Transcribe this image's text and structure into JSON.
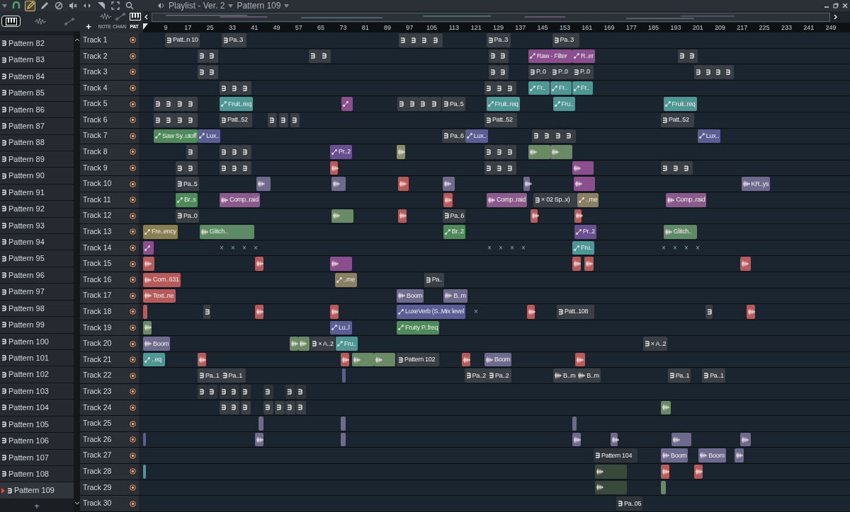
{
  "window": {
    "title": "Playlist - Ver. 2",
    "pattern": "Pattern 109"
  },
  "tools": [
    {
      "kind": "snap",
      "selected": false
    },
    {
      "kind": "draw",
      "selected": true
    },
    {
      "kind": "paint",
      "selected": false
    },
    {
      "kind": "delete",
      "selected": false
    },
    {
      "kind": "mute",
      "selected": false
    },
    {
      "kind": "slip",
      "selected": false
    },
    {
      "kind": "select",
      "selected": false
    },
    {
      "kind": "zoom",
      "selected": false
    },
    {
      "kind": "playback",
      "selected": false
    }
  ],
  "browser_tabs": [
    {
      "kind": "pattern",
      "selected": true
    },
    {
      "kind": "audio",
      "selected": false
    },
    {
      "kind": "automation",
      "selected": false
    }
  ],
  "view_tabs": [
    {
      "kind": "audio",
      "label": "NOTE",
      "selected": false
    },
    {
      "kind": "automation",
      "label": "CHAN",
      "selected": false
    },
    {
      "kind": "pattern",
      "label": "PAT",
      "selected": true
    }
  ],
  "patterns": [
    {
      "name": "Pattern 82",
      "selected": false
    },
    {
      "name": "Pattern 83",
      "selected": false
    },
    {
      "name": "Pattern 84",
      "selected": false
    },
    {
      "name": "Pattern 85",
      "selected": false
    },
    {
      "name": "Pattern 86",
      "selected": false
    },
    {
      "name": "Pattern 87",
      "selected": false
    },
    {
      "name": "Pattern 88",
      "selected": false
    },
    {
      "name": "Pattern 89",
      "selected": false
    },
    {
      "name": "Pattern 90",
      "selected": false
    },
    {
      "name": "Pattern 91",
      "selected": false
    },
    {
      "name": "Pattern 92",
      "selected": false
    },
    {
      "name": "Pattern 93",
      "selected": false
    },
    {
      "name": "Pattern 94",
      "selected": false
    },
    {
      "name": "Pattern 95",
      "selected": false
    },
    {
      "name": "Pattern 96",
      "selected": false
    },
    {
      "name": "Pattern 97",
      "selected": false
    },
    {
      "name": "Pattern 98",
      "selected": false
    },
    {
      "name": "Pattern 99",
      "selected": false
    },
    {
      "name": "Pattern 100",
      "selected": false
    },
    {
      "name": "Pattern 101",
      "selected": false
    },
    {
      "name": "Pattern 102",
      "selected": false
    },
    {
      "name": "Pattern 103",
      "selected": false
    },
    {
      "name": "Pattern 104",
      "selected": false
    },
    {
      "name": "Pattern 105",
      "selected": false
    },
    {
      "name": "Pattern 106",
      "selected": false
    },
    {
      "name": "Pattern 107",
      "selected": false
    },
    {
      "name": "Pattern 108",
      "selected": false
    },
    {
      "name": "Pattern 109",
      "selected": true
    }
  ],
  "add_pattern": "+",
  "add_track": "+",
  "ruler": [
    "9",
    "17",
    "25",
    "33",
    "41",
    "49",
    "57",
    "65",
    "73",
    "81",
    "89",
    "97",
    "105",
    "113",
    "121",
    "129",
    "137",
    "145",
    "153",
    "161",
    "169",
    "177",
    "185",
    "193",
    "201",
    "209",
    "217",
    "225",
    "233",
    "241",
    "249"
  ],
  "tracks": [
    {
      "name": "Track 1",
      "clips": [
        {
          "kind": "pattern",
          "label": "Patt..n 10",
          "color": "#3a3f46"
        },
        {
          "kind": "pattern",
          "label": "Pa..3",
          "color": "#3a3f46"
        },
        {
          "kind": "pattern",
          "color": "#3a3f46"
        },
        {
          "kind": "pattern",
          "color": "#3a3f46"
        },
        {
          "kind": "pattern",
          "color": "#3a3f46"
        },
        {
          "kind": "pattern",
          "color": "#3a3f46"
        },
        {
          "kind": "pattern",
          "label": "Pa..3",
          "color": "#3a3f46"
        },
        {
          "kind": "pattern",
          "label": "Pa..3",
          "color": "#3a3f46"
        }
      ]
    },
    {
      "name": "Track 2",
      "clips": [
        {
          "kind": "pattern",
          "color": "#3a3f46"
        },
        {
          "kind": "pattern",
          "color": "#3a3f46"
        },
        {
          "kind": "pattern",
          "color": "#3a3f46"
        },
        {
          "kind": "pattern",
          "color": "#3a3f46"
        },
        {
          "kind": "pattern",
          "color": "#3a3f46"
        },
        {
          "kind": "pattern",
          "color": "#3a3f46"
        },
        {
          "kind": "automation",
          "label": "Raw - Filter",
          "color": "#8a4f8c"
        },
        {
          "kind": "automation",
          "label": "R..er",
          "color": "#8a4f8c"
        },
        {
          "kind": "pattern",
          "color": "#3a3f46"
        },
        {
          "kind": "pattern",
          "color": "#3a3f46"
        }
      ]
    },
    {
      "name": "Track 3",
      "clips": [
        {
          "kind": "pattern",
          "color": "#3a3f46"
        },
        {
          "kind": "pattern",
          "color": "#3a3f46"
        },
        {
          "kind": "pattern",
          "color": "#3a3f46"
        },
        {
          "kind": "pattern",
          "color": "#3a3f46"
        },
        {
          "kind": "pattern",
          "label": "P..0",
          "color": "#3a3f46"
        },
        {
          "kind": "pattern",
          "label": "P..0",
          "color": "#3a3f46"
        },
        {
          "kind": "pattern",
          "label": "P..0",
          "color": "#3a3f46"
        },
        {
          "kind": "pattern",
          "color": "#3a3f46"
        },
        {
          "kind": "pattern",
          "color": "#3a3f46"
        },
        {
          "kind": "pattern",
          "color": "#3a3f46"
        },
        {
          "kind": "pattern",
          "color": "#3a3f46"
        }
      ]
    },
    {
      "name": "Track 4",
      "clips": [
        {
          "kind": "pattern",
          "color": "#3a3f46"
        },
        {
          "kind": "pattern",
          "color": "#3a3f46"
        },
        {
          "kind": "pattern",
          "color": "#3a3f46"
        },
        {
          "kind": "pattern",
          "color": "#3a3f46"
        },
        {
          "kind": "pattern",
          "color": "#3a3f46"
        },
        {
          "kind": "pattern",
          "color": "#3a3f46"
        },
        {
          "kind": "automation",
          "label": "Fr..",
          "color": "#4f9794"
        },
        {
          "kind": "automation",
          "label": "Fr..",
          "color": "#4f9794"
        },
        {
          "kind": "automation",
          "label": "Fr..",
          "color": "#4f9794"
        }
      ]
    },
    {
      "name": "Track 5",
      "clips": [
        {
          "kind": "pattern",
          "color": "#3a3f46"
        },
        {
          "kind": "pattern",
          "color": "#3a3f46"
        },
        {
          "kind": "pattern",
          "color": "#3a3f46"
        },
        {
          "kind": "pattern",
          "color": "#3a3f46"
        },
        {
          "kind": "automation",
          "label": "Fruit..req",
          "color": "#4f9794"
        },
        {
          "kind": "automation",
          "color": "#8a4f8c"
        },
        {
          "kind": "pattern",
          "color": "#3a3f46"
        },
        {
          "kind": "pattern",
          "color": "#3a3f46"
        },
        {
          "kind": "pattern",
          "color": "#3a3f46"
        },
        {
          "kind": "pattern",
          "color": "#3a3f46"
        },
        {
          "kind": "pattern",
          "label": "Pa..5",
          "color": "#3a3f46"
        },
        {
          "kind": "automation",
          "label": "Fruit..req",
          "color": "#4f9794"
        },
        {
          "kind": "automation",
          "label": "Fru..",
          "color": "#4f9794"
        },
        {
          "kind": "automation",
          "label": "Fruit..req",
          "color": "#4f9794"
        }
      ]
    },
    {
      "name": "Track 6",
      "clips": [
        {
          "kind": "pattern",
          "color": "#3a3f46"
        },
        {
          "kind": "pattern",
          "color": "#3a3f46"
        },
        {
          "kind": "pattern",
          "color": "#3a3f46"
        },
        {
          "kind": "pattern",
          "color": "#3a3f46"
        },
        {
          "kind": "pattern",
          "label": "Patt..52",
          "color": "#3a3f46"
        },
        {
          "kind": "pattern",
          "color": "#3a3f46"
        },
        {
          "kind": "pattern",
          "color": "#3a3f46"
        },
        {
          "kind": "pattern",
          "color": "#3a3f46"
        },
        {
          "kind": "pattern",
          "label": "Patt..52",
          "color": "#3a3f46"
        },
        {
          "kind": "pattern",
          "label": "Patt..52",
          "color": "#3a3f46"
        }
      ]
    },
    {
      "name": "Track 7",
      "clips": [
        {
          "kind": "automation",
          "label": "Saw Sy..utoff",
          "color": "#4f8a5a"
        },
        {
          "kind": "automation",
          "label": "Lux..",
          "color": "#5b5e95"
        },
        {
          "kind": "pattern",
          "label": "Pa..6",
          "color": "#3a3f46"
        },
        {
          "kind": "automation",
          "label": "Lux..",
          "color": "#5b5e95"
        },
        {
          "kind": "pattern",
          "color": "#3a3f46"
        },
        {
          "kind": "pattern",
          "color": "#3a3f46"
        },
        {
          "kind": "pattern",
          "color": "#3a3f46"
        },
        {
          "kind": "pattern",
          "color": "#3a3f46"
        },
        {
          "kind": "automation",
          "label": "Lux..",
          "color": "#5b5e95"
        }
      ]
    },
    {
      "name": "Track 8",
      "clips": [
        {
          "kind": "pattern",
          "color": "#3a3f46"
        },
        {
          "kind": "pattern",
          "color": "#3a3f46"
        },
        {
          "kind": "pattern",
          "color": "#3a3f46"
        },
        {
          "kind": "pattern",
          "color": "#3a3f46"
        },
        {
          "kind": "automation",
          "label": "Pr..2",
          "color": "#6a4f8f"
        },
        {
          "kind": "audio",
          "color": "#8a8f6a"
        },
        {
          "kind": "pattern",
          "color": "#3a3f46"
        },
        {
          "kind": "pattern",
          "color": "#3a3f46"
        },
        {
          "kind": "pattern",
          "color": "#3a3f46"
        },
        {
          "kind": "audio",
          "color": "#6a8a66"
        },
        {
          "kind": "audio",
          "color": "#6a8a66"
        }
      ]
    },
    {
      "name": "Track 9",
      "clips": [
        {
          "kind": "pattern",
          "color": "#3a3f46"
        },
        {
          "kind": "pattern",
          "color": "#3a3f46"
        },
        {
          "kind": "pattern",
          "color": "#3a3f46"
        },
        {
          "kind": "pattern",
          "color": "#3a3f46"
        },
        {
          "kind": "pattern",
          "color": "#3a3f46"
        },
        {
          "kind": "audio",
          "color": "#b85a5a"
        },
        {
          "kind": "pattern",
          "color": "#3a3f46"
        },
        {
          "kind": "pattern",
          "color": "#3a3f46"
        },
        {
          "kind": "pattern",
          "color": "#3a3f46"
        },
        {
          "kind": "audio",
          "color": "#8a4f8c"
        },
        {
          "kind": "pattern",
          "color": "#3a3f46"
        },
        {
          "kind": "pattern",
          "color": "#3a3f46"
        },
        {
          "kind": "pattern",
          "color": "#3a3f46"
        }
      ]
    },
    {
      "name": "Track 10",
      "clips": [
        {
          "kind": "pattern",
          "label": "Pa..5",
          "color": "#3a3f46"
        },
        {
          "kind": "audio",
          "color": "#6e6a8e"
        },
        {
          "kind": "audio",
          "color": "#6e6a8e"
        },
        {
          "kind": "audio",
          "color": "#b85a5a"
        },
        {
          "kind": "audio",
          "color": "#6e6a8e"
        },
        {
          "kind": "audio",
          "color": "#6e6a8e"
        },
        {
          "kind": "audio",
          "color": "#8a4f8c"
        },
        {
          "kind": "audio",
          "label": "KR..ys",
          "color": "#6e6a8e"
        }
      ]
    },
    {
      "name": "Track 11",
      "clips": [
        {
          "kind": "automation",
          "label": "Br..s",
          "color": "#4f8a5a"
        },
        {
          "kind": "audio",
          "label": "Comp..raid",
          "color": "#8a5a8c"
        },
        {
          "kind": "audio",
          "color": "#b85a5a"
        },
        {
          "kind": "audio",
          "label": "Comp..raid",
          "color": "#8a5a8c"
        },
        {
          "kind": "pattern",
          "label": "× 02 Sp..x)",
          "color": "#3a3f46"
        },
        {
          "kind": "automation",
          "label": "..me",
          "color": "#8a7f62"
        },
        {
          "kind": "audio",
          "label": "Comp..raid",
          "color": "#8a5a8c"
        }
      ]
    },
    {
      "name": "Track 12",
      "clips": [
        {
          "kind": "pattern",
          "label": "Pa..0",
          "color": "#3a3f46"
        },
        {
          "kind": "audio",
          "color": "#6a8a66"
        },
        {
          "kind": "audio",
          "color": "#b85a5a"
        },
        {
          "kind": "pattern",
          "label": "Pa..6",
          "color": "#3a3f46"
        },
        {
          "kind": "audio",
          "color": "#b85a5a"
        },
        {
          "kind": "audio",
          "color": "#b85a5a"
        }
      ]
    },
    {
      "name": "Track 13",
      "clips": [
        {
          "kind": "automation",
          "label": "Fre..ency",
          "color": "#8a7f52"
        },
        {
          "kind": "audio",
          "label": "Glitch..",
          "color": "#5f8a66"
        },
        {
          "kind": "automation",
          "label": "Br..2",
          "color": "#4f8a5a"
        },
        {
          "kind": "automation",
          "label": "Pr..2",
          "color": "#6a4f8f"
        },
        {
          "kind": "audio",
          "label": "Glitch..",
          "color": "#5f8a66"
        }
      ]
    },
    {
      "name": "Track 14",
      "clips": [
        {
          "kind": "automation",
          "color": "#8a4f8c"
        },
        {
          "kind": "marker",
          "label": "×"
        },
        {
          "kind": "marker",
          "label": "×"
        },
        {
          "kind": "marker",
          "label": "×"
        },
        {
          "kind": "marker",
          "label": "×"
        },
        {
          "kind": "marker",
          "label": "×"
        },
        {
          "kind": "marker",
          "label": "×"
        },
        {
          "kind": "marker",
          "label": "×"
        },
        {
          "kind": "marker",
          "label": "×"
        },
        {
          "kind": "automation",
          "label": "Fru..",
          "color": "#4f9794"
        },
        {
          "kind": "marker",
          "label": "×"
        },
        {
          "kind": "marker",
          "label": "×"
        },
        {
          "kind": "marker",
          "label": "×"
        },
        {
          "kind": "marker",
          "label": "×"
        }
      ]
    },
    {
      "name": "Track 15",
      "clips": [
        {
          "kind": "audio",
          "color": "#b85a5a"
        },
        {
          "kind": "audio",
          "color": "#b85a5a"
        },
        {
          "kind": "audio",
          "color": "#8a4f8c"
        },
        {
          "kind": "audio",
          "color": "#b85a5a"
        },
        {
          "kind": "audio",
          "color": "#b85a5a"
        },
        {
          "kind": "audio",
          "color": "#b85a5a"
        }
      ]
    },
    {
      "name": "Track 16",
      "clips": [
        {
          "kind": "audio",
          "label": "Com..631",
          "color": "#b85a5a"
        },
        {
          "kind": "automation",
          "label": "..me",
          "color": "#8a7f62"
        },
        {
          "kind": "pattern",
          "label": "Pa..",
          "color": "#3a3f46"
        }
      ]
    },
    {
      "name": "Track 17",
      "clips": [
        {
          "kind": "audio",
          "label": "Text..ne",
          "color": "#b85a5a"
        },
        {
          "kind": "audio",
          "label": "Boom",
          "color": "#6e6a8e"
        },
        {
          "kind": "audio",
          "label": "B..m",
          "color": "#6e6a8e"
        }
      ]
    },
    {
      "name": "Track 18",
      "clips": [
        {
          "kind": "audio",
          "color": "#b85a5a"
        },
        {
          "kind": "pattern",
          "color": "#3a3f46"
        },
        {
          "kind": "audio",
          "color": "#b85a5a"
        },
        {
          "kind": "audio",
          "color": "#b85a5a"
        },
        {
          "kind": "automation",
          "label": "LuxeVerb (S..Mix level",
          "color": "#5b5e95"
        },
        {
          "kind": "marker",
          "label": "×"
        },
        {
          "kind": "audio",
          "color": "#b85a5a"
        },
        {
          "kind": "pattern",
          "label": "Patt..108",
          "color": "#3a3f46"
        },
        {
          "kind": "pattern",
          "color": "#3a3f46"
        },
        {
          "kind": "audio",
          "color": "#b85a5a"
        }
      ]
    },
    {
      "name": "Track 19",
      "clips": [
        {
          "kind": "audio",
          "color": "#6a8a66"
        },
        {
          "kind": "automation",
          "label": "Lu..l",
          "color": "#5b5e95"
        },
        {
          "kind": "automation",
          "label": "Fruity P..freq",
          "color": "#4f8a5a"
        }
      ]
    },
    {
      "name": "Track 20",
      "clips": [
        {
          "kind": "audio",
          "label": "Boom",
          "color": "#6e6a8e"
        },
        {
          "kind": "audio",
          "color": "#6a8a66"
        },
        {
          "kind": "audio",
          "color": "#6a8a66"
        },
        {
          "kind": "pattern",
          "label": "× A..2",
          "color": "#3a3f46"
        },
        {
          "kind": "automation",
          "label": "Fru..",
          "color": "#4f9794"
        },
        {
          "kind": "pattern",
          "label": "× A..2",
          "color": "#3a3f46"
        }
      ]
    },
    {
      "name": "Track 21",
      "clips": [
        {
          "kind": "automation",
          "label": "..eq",
          "color": "#4f9794"
        },
        {
          "kind": "audio",
          "color": "#b85a5a"
        },
        {
          "kind": "audio",
          "color": "#b85a5a"
        },
        {
          "kind": "audio",
          "color": "#6a8a66"
        },
        {
          "kind": "audio",
          "color": "#6a8a66"
        },
        {
          "kind": "pattern",
          "label": "Pattern 102",
          "color": "#3a3f46"
        },
        {
          "kind": "audio",
          "color": "#b85a5a"
        },
        {
          "kind": "audio",
          "label": "Boom",
          "color": "#6e6a8e"
        },
        {
          "kind": "audio",
          "color": "#b85a5a"
        }
      ]
    },
    {
      "name": "Track 22",
      "clips": [
        {
          "kind": "pattern",
          "label": "Pa..1",
          "color": "#3a3f46"
        },
        {
          "kind": "pattern",
          "label": "Pa..1",
          "color": "#3a3f46"
        },
        {
          "kind": "automation",
          "color": "#5b5e95"
        },
        {
          "kind": "pattern",
          "label": "Pa..2",
          "color": "#3a3f46"
        },
        {
          "kind": "pattern",
          "label": "Pa..2",
          "color": "#3a3f46"
        },
        {
          "kind": "audio",
          "label": "B..m",
          "color": "#3a3f46"
        },
        {
          "kind": "audio",
          "label": "B..m",
          "color": "#3a3f46"
        },
        {
          "kind": "pattern",
          "label": "Pa..1",
          "color": "#3a3f46"
        },
        {
          "kind": "pattern",
          "label": "Pa..1",
          "color": "#3a3f46"
        }
      ]
    },
    {
      "name": "Track 23",
      "clips": [
        {
          "kind": "pattern",
          "color": "#2f343a"
        },
        {
          "kind": "pattern",
          "color": "#2f343a"
        },
        {
          "kind": "pattern",
          "color": "#2f343a"
        },
        {
          "kind": "pattern",
          "color": "#2f343a"
        },
        {
          "kind": "pattern",
          "color": "#2f343a"
        },
        {
          "kind": "pattern",
          "color": "#2f343a"
        },
        {
          "kind": "pattern",
          "color": "#2f343a"
        },
        {
          "kind": "pattern",
          "color": "#2f343a"
        }
      ]
    },
    {
      "name": "Track 24",
      "clips": [
        {
          "kind": "pattern",
          "color": "#3a3f46"
        },
        {
          "kind": "pattern",
          "color": "#3a3f46"
        },
        {
          "kind": "pattern",
          "color": "#3a3f46"
        },
        {
          "kind": "pattern",
          "color": "#3a3f46"
        },
        {
          "kind": "pattern",
          "color": "#3a3f46"
        },
        {
          "kind": "pattern",
          "color": "#3a3f46"
        },
        {
          "kind": "pattern",
          "color": "#3a3f46"
        },
        {
          "kind": "audio",
          "color": "#6a8a66"
        }
      ]
    },
    {
      "name": "Track 25",
      "clips": [
        {
          "kind": "audio",
          "color": "#6e6a8e"
        },
        {
          "kind": "audio",
          "color": "#6e6a8e"
        },
        {
          "kind": "audio",
          "color": "#6e6a8e"
        }
      ]
    },
    {
      "name": "Track 26",
      "clips": [
        {
          "kind": "audio",
          "color": "#5b5e95"
        },
        {
          "kind": "audio",
          "color": "#6e6a8e"
        },
        {
          "kind": "audio",
          "color": "#6e6a8e"
        },
        {
          "kind": "audio",
          "color": "#6e6a8e"
        },
        {
          "kind": "audio",
          "color": "#6e6a8e"
        },
        {
          "kind": "audio",
          "color": "#6e6a8e"
        },
        {
          "kind": "audio",
          "color": "#6e6a8e"
        }
      ]
    },
    {
      "name": "Track 27",
      "clips": [
        {
          "kind": "pattern",
          "label": "Pattern 104",
          "color": "#2f343a"
        },
        {
          "kind": "audio",
          "label": "Boom",
          "color": "#6e6a8e"
        },
        {
          "kind": "audio",
          "label": "Boom",
          "color": "#6e6a8e"
        },
        {
          "kind": "audio",
          "color": "#6e6a8e"
        }
      ]
    },
    {
      "name": "Track 28",
      "clips": [
        {
          "kind": "audio",
          "color": "#4f9794"
        },
        {
          "kind": "audio",
          "color": "#3a4a3a"
        },
        {
          "kind": "audio",
          "color": "#b85a5a"
        },
        {
          "kind": "audio",
          "color": "#b85a5a"
        }
      ]
    },
    {
      "name": "Track 29",
      "clips": [
        {
          "kind": "audio",
          "color": "#3a4a3a"
        },
        {
          "kind": "audio",
          "color": "#6a8a66"
        }
      ]
    },
    {
      "name": "Track 30",
      "clips": [
        {
          "kind": "pattern",
          "label": "Pa..05",
          "color": "#2f343a"
        }
      ]
    }
  ]
}
